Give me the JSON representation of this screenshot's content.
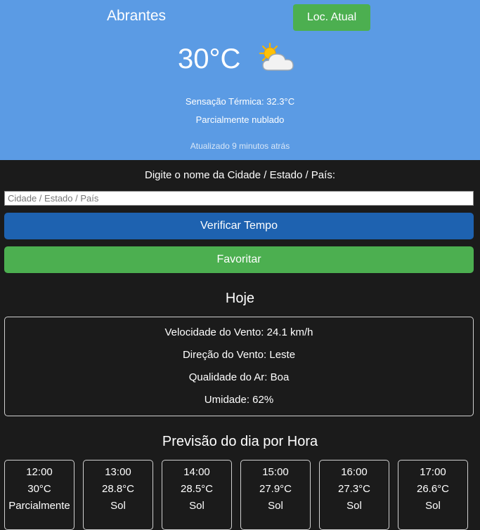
{
  "header": {
    "city": "Abrantes",
    "location_button": "Loc. Atual",
    "temperature": "30°C",
    "weather_icon": "partly-cloudy-icon",
    "feels_like": "Sensação Térmica: 32.3°C",
    "condition": "Parcialmente nublado",
    "updated": "Atualizado 9 minutos atrás"
  },
  "search": {
    "prompt": "Digite o nome da Cidade / Estado / País:",
    "placeholder": "Cidade / Estado / País",
    "check_button": "Verificar Tempo",
    "favorite_button": "Favoritar"
  },
  "today": {
    "title": "Hoje",
    "wind_speed": "Velocidade do Vento: 24.1 km/h",
    "wind_direction": "Direção do Vento: Leste",
    "air_quality": "Qualidade do Ar: Boa",
    "humidity": "Umidade: 62%"
  },
  "hourly": {
    "title": "Previsão do dia por Hora",
    "items": [
      {
        "time": "12:00",
        "temp": "30°C",
        "cond": "Parcialmente"
      },
      {
        "time": "13:00",
        "temp": "28.8°C",
        "cond": "Sol"
      },
      {
        "time": "14:00",
        "temp": "28.5°C",
        "cond": "Sol"
      },
      {
        "time": "15:00",
        "temp": "27.9°C",
        "cond": "Sol"
      },
      {
        "time": "16:00",
        "temp": "27.3°C",
        "cond": "Sol"
      },
      {
        "time": "17:00",
        "temp": "26.6°C",
        "cond": "Sol"
      }
    ]
  },
  "colors": {
    "header_bg": "#5b9be4",
    "page_bg": "#1b1b1b",
    "primary_button": "#1e62b0",
    "success_button": "#4caf50"
  }
}
